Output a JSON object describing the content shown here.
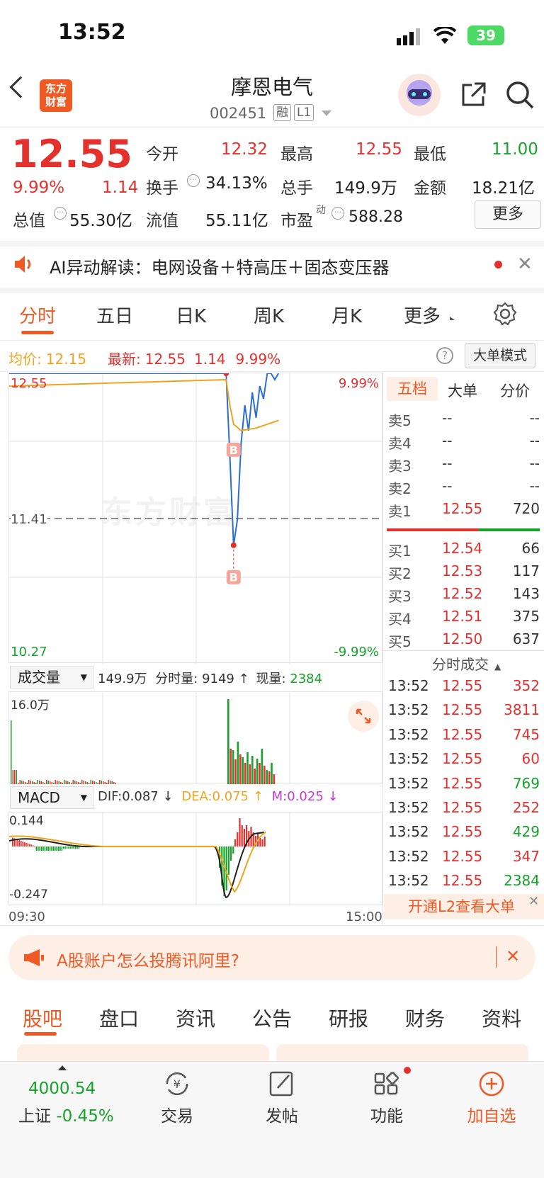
{
  "status_bar": {
    "time": "13:52",
    "battery": "39"
  },
  "nav": {
    "logo_line1": "东方",
    "logo_line2": "财富",
    "title": "摩恩电气",
    "code": "002451",
    "tag_rong": "融",
    "tag_l1": "L1"
  },
  "quote": {
    "price": "12.55",
    "change_pct": "9.99%",
    "change": "1.14",
    "open_label": "今开",
    "open": "12.32",
    "high_label": "最高",
    "high": "12.55",
    "low_label": "最低",
    "low": "11.00",
    "turnover_label": "换手",
    "turnover": "34.13%",
    "vol_label": "总手",
    "vol": "149.9万",
    "amount_label": "金额",
    "amount": "18.21亿",
    "mktcap_label": "总值",
    "mktcap": "55.30亿",
    "float_label": "流值",
    "float": "55.11亿",
    "pe_label": "市盈",
    "pe_sup": "动",
    "pe": "588.28",
    "more": "更多"
  },
  "ai_bar": {
    "text": "AI异动解读：电网设备＋特高压＋固态变压器"
  },
  "period_tabs": [
    "分时",
    "五日",
    "日K",
    "周K",
    "月K",
    "更多"
  ],
  "chart_info": {
    "avg_label": "均价:",
    "avg": "12.15",
    "latest_label": "最新:",
    "latest": "12.55",
    "chg": "1.14",
    "pct": "9.99%",
    "mode_btn": "大单模式"
  },
  "chart_data": {
    "type": "line",
    "x_labels": [
      "09:30",
      "15:00"
    ],
    "y_max": "12.55",
    "y_prev_close": "11.41",
    "y_min": "10.27",
    "pct_max": "9.99%",
    "pct_min": "-9.99%",
    "ylim": [
      10.27,
      12.55
    ],
    "series": [
      {
        "name": "price",
        "color": "#2c6fcf",
        "points": [
          [
            0,
            12.55
          ],
          [
            0.58,
            12.55
          ],
          [
            0.59,
            11.9
          ],
          [
            0.6,
            11.2
          ],
          [
            0.61,
            11.4
          ],
          [
            0.62,
            12.0
          ],
          [
            0.63,
            12.3
          ],
          [
            0.64,
            12.1
          ],
          [
            0.65,
            12.4
          ],
          [
            0.66,
            12.2
          ],
          [
            0.67,
            12.45
          ],
          [
            0.68,
            12.35
          ],
          [
            0.69,
            12.55
          ],
          [
            0.7,
            12.55
          ],
          [
            0.71,
            12.5
          ],
          [
            0.72,
            12.55
          ]
        ]
      },
      {
        "name": "avg",
        "color": "#f0a41e",
        "points": [
          [
            0,
            12.45
          ],
          [
            0.58,
            12.5
          ],
          [
            0.59,
            12.3
          ],
          [
            0.6,
            12.15
          ],
          [
            0.62,
            12.1
          ],
          [
            0.66,
            12.12
          ],
          [
            0.72,
            12.18
          ]
        ]
      }
    ],
    "markers": [
      "B",
      "B"
    ],
    "watermark": "东方财富"
  },
  "volume": {
    "selector": "成交量",
    "total": "149.9万",
    "fenshi_label": "分时量:",
    "fenshi": "9149",
    "arrow": "↑",
    "current_label": "现量:",
    "current": "2384",
    "scale": "16.0万"
  },
  "macd": {
    "selector": "MACD",
    "dif": "DIF:0.087 ↓",
    "dea": "DEA:0.075 ↑",
    "m": "M:0.025 ↓",
    "top": "0.144",
    "bottom": "-0.247"
  },
  "time_axis": {
    "start": "09:30",
    "end": "15:00"
  },
  "order_book": {
    "tabs": [
      "五档",
      "大单",
      "分价"
    ],
    "asks": [
      {
        "label": "卖5",
        "price": "--",
        "vol": "--"
      },
      {
        "label": "卖4",
        "price": "--",
        "vol": "--"
      },
      {
        "label": "卖3",
        "price": "--",
        "vol": "--"
      },
      {
        "label": "卖2",
        "price": "--",
        "vol": "--"
      },
      {
        "label": "卖1",
        "price": "12.55",
        "vol": "720"
      }
    ],
    "bids": [
      {
        "label": "买1",
        "price": "12.54",
        "vol": "66"
      },
      {
        "label": "买2",
        "price": "12.53",
        "vol": "117"
      },
      {
        "label": "买3",
        "price": "12.52",
        "vol": "143"
      },
      {
        "label": "买4",
        "price": "12.51",
        "vol": "375"
      },
      {
        "label": "买5",
        "price": "12.50",
        "vol": "637"
      }
    ]
  },
  "trades": {
    "header": "分时成交",
    "rows": [
      {
        "t": "13:52",
        "p": "12.55",
        "v": "352",
        "dir": "up"
      },
      {
        "t": "13:52",
        "p": "12.55",
        "v": "3811",
        "dir": "up"
      },
      {
        "t": "13:52",
        "p": "12.55",
        "v": "745",
        "dir": "up"
      },
      {
        "t": "13:52",
        "p": "12.55",
        "v": "60",
        "dir": "up"
      },
      {
        "t": "13:52",
        "p": "12.55",
        "v": "769",
        "dir": "down"
      },
      {
        "t": "13:52",
        "p": "12.55",
        "v": "252",
        "dir": "up"
      },
      {
        "t": "13:52",
        "p": "12.55",
        "v": "429",
        "dir": "down"
      },
      {
        "t": "13:52",
        "p": "12.55",
        "v": "347",
        "dir": "up"
      },
      {
        "t": "13:52",
        "p": "12.55",
        "v": "2384",
        "dir": "down"
      }
    ],
    "l2": "开通L2查看大单"
  },
  "promo": {
    "text": "A股账户怎么投腾讯阿里?"
  },
  "bottom_tabs": [
    "股吧",
    "盘口",
    "资讯",
    "公告",
    "研报",
    "财务",
    "资料"
  ],
  "bottom_nav": {
    "index_value": "4000.54",
    "index_name": "上证",
    "index_change": "-0.45%",
    "trade": "交易",
    "post": "发帖",
    "func": "功能",
    "add": "加自选"
  }
}
